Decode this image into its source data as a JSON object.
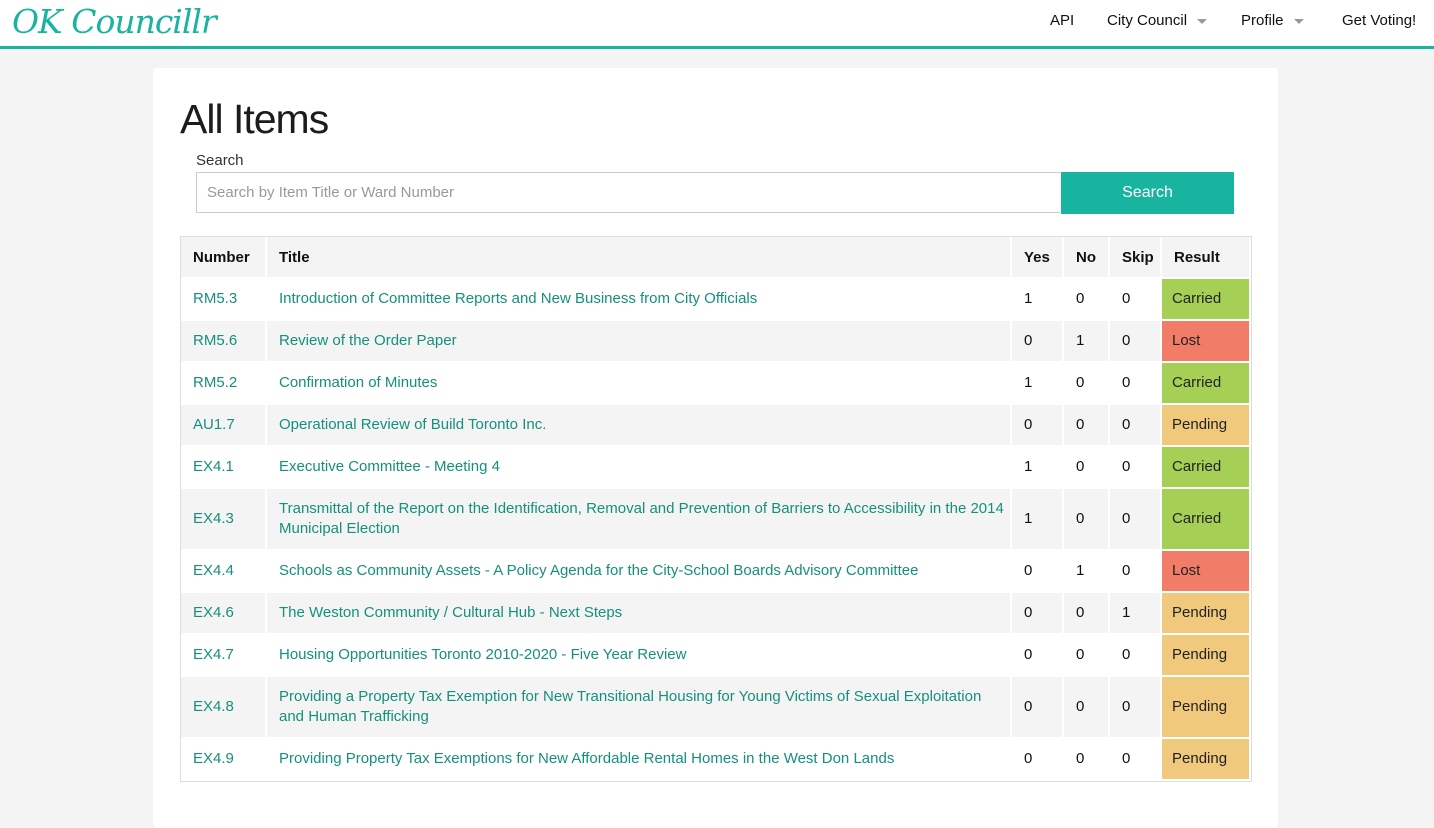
{
  "navbar": {
    "logo": "OK Councillr",
    "items": [
      {
        "label": "API"
      },
      {
        "label": "City Council"
      },
      {
        "label": "Profile"
      },
      {
        "label": "Get Voting!"
      }
    ]
  },
  "page": {
    "title": "All Items"
  },
  "search": {
    "label": "Search",
    "placeholder": "Search by Item Title or Ward Number",
    "button_label": "Search"
  },
  "table": {
    "headers": [
      "Number",
      "Title",
      "Yes",
      "No",
      "Skip",
      "Result"
    ],
    "rows": [
      {
        "number": "RM5.3",
        "title": "Introduction of Committee Reports and New Business from City Officials",
        "yes": "1",
        "no": "0",
        "skip": "0",
        "result": "Carried"
      },
      {
        "number": "RM5.6",
        "title": "Review of the Order Paper",
        "yes": "0",
        "no": "1",
        "skip": "0",
        "result": "Lost"
      },
      {
        "number": "RM5.2",
        "title": "Confirmation of Minutes",
        "yes": "1",
        "no": "0",
        "skip": "0",
        "result": "Carried"
      },
      {
        "number": "AU1.7",
        "title": "Operational Review of Build Toronto Inc.",
        "yes": "0",
        "no": "0",
        "skip": "0",
        "result": "Pending"
      },
      {
        "number": "EX4.1",
        "title": "Executive Committee - Meeting 4",
        "yes": "1",
        "no": "0",
        "skip": "0",
        "result": "Carried"
      },
      {
        "number": "EX4.3",
        "title": "Transmittal of the Report on the Identification, Removal and Prevention of Barriers to Accessibility in the 2014 Municipal Election",
        "yes": "1",
        "no": "0",
        "skip": "0",
        "result": "Carried"
      },
      {
        "number": "EX4.4",
        "title": "Schools as Community Assets - A Policy Agenda for the City-School Boards Advisory Committee",
        "yes": "0",
        "no": "1",
        "skip": "0",
        "result": "Lost"
      },
      {
        "number": "EX4.6",
        "title": "The Weston Community / Cultural Hub - Next Steps",
        "yes": "0",
        "no": "0",
        "skip": "1",
        "result": "Pending"
      },
      {
        "number": "EX4.7",
        "title": "Housing Opportunities Toronto 2010-2020 - Five Year Review",
        "yes": "0",
        "no": "0",
        "skip": "0",
        "result": "Pending"
      },
      {
        "number": "EX4.8",
        "title": "Providing a Property Tax Exemption for New Transitional Housing for Young Victims of Sexual Exploitation and Human Trafficking",
        "yes": "0",
        "no": "0",
        "skip": "0",
        "result": "Pending"
      },
      {
        "number": "EX4.9",
        "title": "Providing Property Tax Exemptions for New Affordable Rental Homes in the West Don Lands",
        "yes": "0",
        "no": "0",
        "skip": "0",
        "result": "Pending"
      }
    ]
  },
  "colors": {
    "accent": "#19b49f",
    "link": "#15907c",
    "carried": "#a6cf55",
    "lost": "#f17c67",
    "pending": "#f0c97c"
  }
}
